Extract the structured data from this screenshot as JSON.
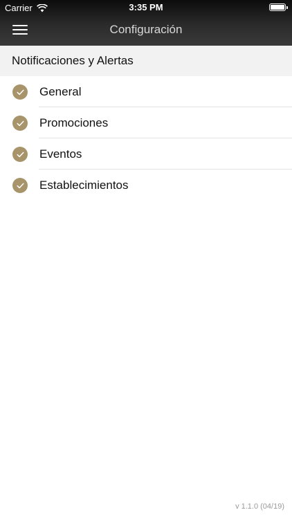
{
  "status_bar": {
    "carrier": "Carrier",
    "time": "3:35 PM"
  },
  "nav": {
    "title": "Configuración",
    "menu_icon": "hamburger-menu-icon"
  },
  "section": {
    "title": "Notificaciones y Alertas"
  },
  "items": [
    {
      "label": "General",
      "checked": true
    },
    {
      "label": "Promociones",
      "checked": true
    },
    {
      "label": "Eventos",
      "checked": true
    },
    {
      "label": "Establecimientos",
      "checked": true
    }
  ],
  "footer": {
    "version": "v 1.1.0 (04/19)"
  },
  "colors": {
    "accent": "#a8946a",
    "header_dark": "#1a1a1a",
    "section_bg": "#f2f2f2"
  }
}
